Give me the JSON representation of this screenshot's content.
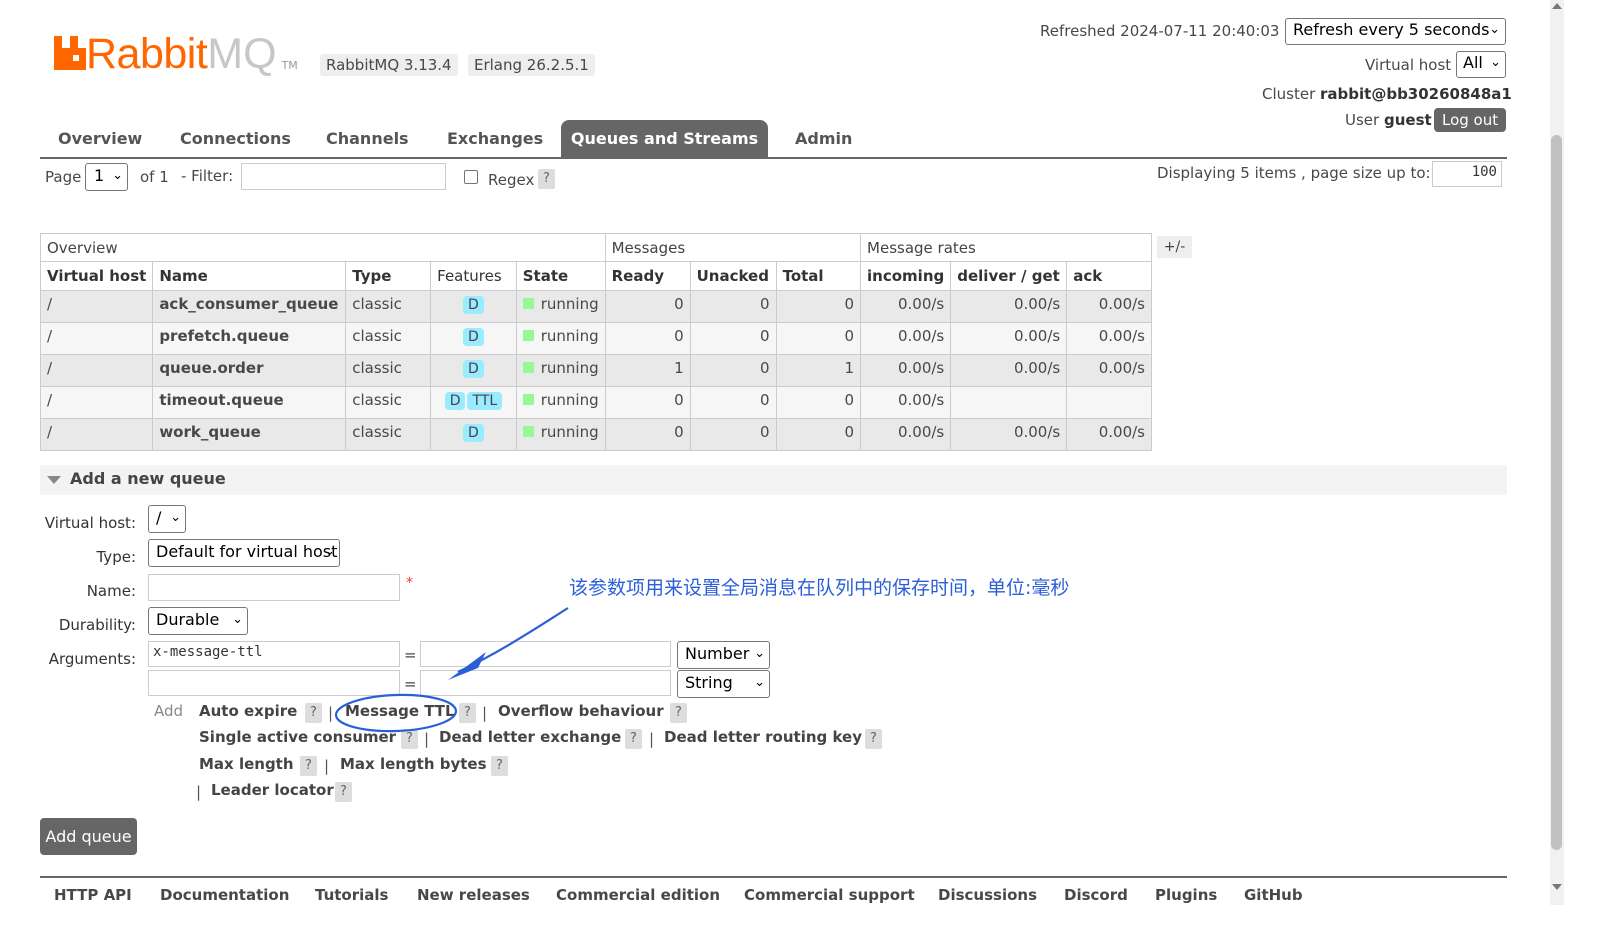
{
  "logo": {
    "rabbit": "Rabbit",
    "mq": "MQ",
    "tm": "TM"
  },
  "versions": {
    "rabbitmq": "RabbitMQ 3.13.4",
    "erlang": "Erlang 26.2.5.1"
  },
  "header": {
    "refreshed_label": "Refreshed 2024-07-11 20:40:03",
    "refresh_select": "Refresh every 5 seconds",
    "vhost_label": "Virtual host",
    "vhost_select": "All",
    "cluster_label": "Cluster",
    "cluster_value": "rabbit@bb30260848a1",
    "user_label": "User",
    "user_value": "guest",
    "logout": "Log out"
  },
  "tabs": [
    "Overview",
    "Connections",
    "Channels",
    "Exchanges",
    "Queues and Streams",
    "Admin"
  ],
  "active_tab": "Queues and Streams",
  "paging": {
    "page_label": "Page",
    "page_value": "1",
    "of_label": "of 1",
    "filter_label": "- Filter:",
    "filter_value": "",
    "regex_label": "Regex",
    "help": "?",
    "display_text": "Displaying 5 items , page size up to:",
    "page_size": "100"
  },
  "table": {
    "groups": [
      "Overview",
      "Messages",
      "Message rates"
    ],
    "columns": [
      "Virtual host",
      "Name",
      "Type",
      "Features",
      "State",
      "Ready",
      "Unacked",
      "Total",
      "incoming",
      "deliver / get",
      "ack"
    ],
    "toggle": "+/-",
    "rows": [
      {
        "vhost": "/",
        "name": "ack_consumer_queue",
        "type": "classic",
        "features": [
          "D"
        ],
        "state": "running",
        "ready": "0",
        "unacked": "0",
        "total": "0",
        "incoming": "0.00/s",
        "deliver": "0.00/s",
        "ack": "0.00/s"
      },
      {
        "vhost": "/",
        "name": "prefetch.queue",
        "type": "classic",
        "features": [
          "D"
        ],
        "state": "running",
        "ready": "0",
        "unacked": "0",
        "total": "0",
        "incoming": "0.00/s",
        "deliver": "0.00/s",
        "ack": "0.00/s"
      },
      {
        "vhost": "/",
        "name": "queue.order",
        "type": "classic",
        "features": [
          "D"
        ],
        "state": "running",
        "ready": "1",
        "unacked": "0",
        "total": "1",
        "incoming": "0.00/s",
        "deliver": "0.00/s",
        "ack": "0.00/s"
      },
      {
        "vhost": "/",
        "name": "timeout.queue",
        "type": "classic",
        "features": [
          "D",
          "TTL"
        ],
        "state": "running",
        "ready": "0",
        "unacked": "0",
        "total": "0",
        "incoming": "0.00/s",
        "deliver": "",
        "ack": ""
      },
      {
        "vhost": "/",
        "name": "work_queue",
        "type": "classic",
        "features": [
          "D"
        ],
        "state": "running",
        "ready": "0",
        "unacked": "0",
        "total": "0",
        "incoming": "0.00/s",
        "deliver": "0.00/s",
        "ack": "0.00/s"
      }
    ]
  },
  "add_queue": {
    "section_title": "Add a new queue",
    "vhost_label": "Virtual host:",
    "vhost_value": "/",
    "type_label": "Type:",
    "type_value": "Default for virtual host",
    "name_label": "Name:",
    "name_value": "",
    "required_mark": "*",
    "durability_label": "Durability:",
    "durability_value": "Durable",
    "arguments_label": "Arguments:",
    "arg1_key": "x-message-ttl",
    "arg1_value": "",
    "arg1_type": "Number",
    "arg2_key": "",
    "arg2_value": "",
    "arg2_type": "String",
    "eq": "=",
    "add_label": "Add",
    "links": {
      "auto_expire": "Auto expire",
      "message_ttl": "Message TTL",
      "overflow": "Overflow behaviour",
      "single_active": "Single active consumer",
      "dlx": "Dead letter exchange",
      "dlrk": "Dead letter routing key",
      "max_length": "Max length",
      "max_length_bytes": "Max length bytes",
      "leader_locator": "Leader locator"
    },
    "separator": "|",
    "submit": "Add queue"
  },
  "annotation": "该参数项用来设置全局消息在队列中的保存时间，单位:毫秒",
  "footer": [
    "HTTP API",
    "Documentation",
    "Tutorials",
    "New releases",
    "Commercial edition",
    "Commercial support",
    "Discussions",
    "Discord",
    "Plugins",
    "GitHub"
  ],
  "colors": {
    "brand": "#ff6600",
    "tab_active": "#666666",
    "feature_badge": "#99ebff",
    "state_running": "#98f898",
    "annotation": "#2b5fd9"
  }
}
